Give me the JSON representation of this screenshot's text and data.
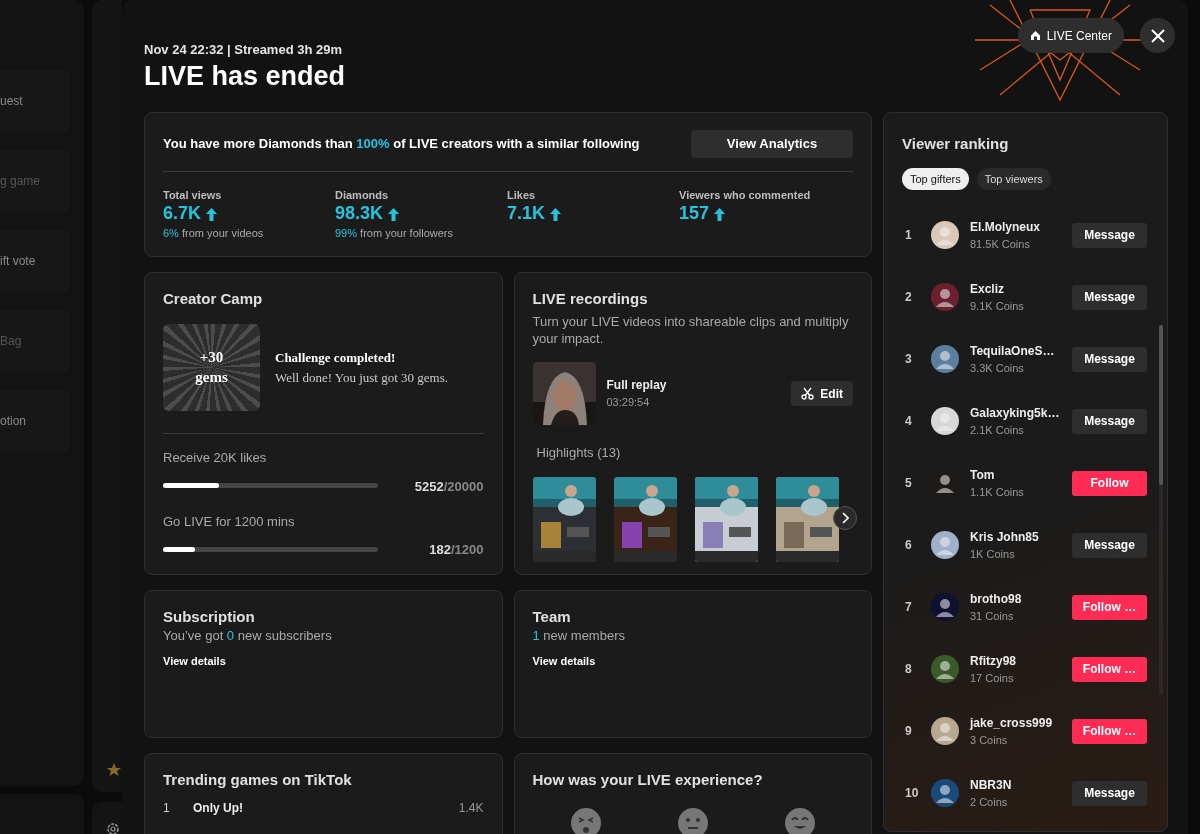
{
  "background_sidebar": {
    "items": [
      {
        "label": "uest",
        "dim": false
      },
      {
        "label": "g game",
        "dim": true
      },
      {
        "label": "ift vote",
        "dim": false
      },
      {
        "label": "Bag",
        "dim": true
      },
      {
        "label": "otion",
        "dim": false
      }
    ]
  },
  "header": {
    "meta": "Nov 24 22:32 | Streamed 3h 29m",
    "title": "LIVE has ended",
    "live_center_button": "LIVE Center"
  },
  "summary": {
    "headline_parts": [
      {
        "text": "You have more Diamonds than ",
        "accent": false
      },
      {
        "text": "100%",
        "accent": true
      },
      {
        "text": " of LIVE creators with a similar following",
        "accent": false
      }
    ],
    "analytics_button": "View Analytics",
    "stats": [
      {
        "label": "Total views",
        "value": "6.7K",
        "note_highlight": "6%",
        "note_text": " from your videos"
      },
      {
        "label": "Diamonds",
        "value": "98.3K",
        "note_highlight": "99%",
        "note_text": " from your followers"
      },
      {
        "label": "Likes",
        "value": "7.1K"
      },
      {
        "label": "Viewers who commented",
        "value": "157"
      }
    ]
  },
  "creator_camp": {
    "title": "Creator Camp",
    "badge": "+30 gems",
    "challenge_title": "Challenge completed!",
    "challenge_text": "Well done! You just got 30 gems.",
    "goals": [
      {
        "label": "Receive 20K likes",
        "level": 0.26,
        "current": "5252",
        "target": "/20000"
      },
      {
        "label": "Go LIVE for 1200 mins",
        "level": 0.15,
        "current": "182",
        "target": "/1200"
      }
    ]
  },
  "recordings": {
    "title": "LIVE recordings",
    "description": "Turn your LIVE videos into shareable clips and multiply your impact.",
    "replay": {
      "title": "Full replay",
      "duration": "03:29:54"
    },
    "edit_button": "Edit",
    "highlights_label": "Highlights (13)"
  },
  "subscription": {
    "title": "Subscription",
    "parts": [
      {
        "text": "You’ve got ",
        "accent": false
      },
      {
        "text": "0",
        "accent": true
      },
      {
        "text": " new subscribers",
        "accent": false
      }
    ],
    "link": "View details"
  },
  "team": {
    "title": "Team",
    "parts": [
      {
        "text": "1",
        "accent": true
      },
      {
        "text": " new members",
        "accent": false
      }
    ],
    "link": "View details"
  },
  "trending": {
    "title": "Trending games on TikTok",
    "games": [
      {
        "rank": "1",
        "name": "Only Up!",
        "count": "1.4K"
      }
    ]
  },
  "experience": {
    "title": "How was your LIVE experience?"
  },
  "viewer_ranking": {
    "title": "Viewer ranking",
    "tabs": [
      {
        "label": "Top gifters",
        "selected": true
      },
      {
        "label": "Top viewers",
        "selected": false
      }
    ],
    "viewers": [
      {
        "rank": "1",
        "name": "El.Molyneux",
        "coins": "81.5K Coins",
        "kind": "message",
        "button": "Message"
      },
      {
        "rank": "2",
        "name": "Excliz",
        "coins": "9.1K Coins",
        "kind": "message",
        "button": "Message"
      },
      {
        "rank": "3",
        "name": "TequilaOneS…",
        "coins": "3.3K Coins",
        "kind": "message",
        "button": "Message"
      },
      {
        "rank": "4",
        "name": "Galaxyking5k…",
        "coins": "2.1K Coins",
        "kind": "message",
        "button": "Message"
      },
      {
        "rank": "5",
        "name": "Tom",
        "coins": "1.1K Coins",
        "kind": "follow",
        "button": "Follow"
      },
      {
        "rank": "6",
        "name": "Kris John85",
        "coins": "1K Coins",
        "kind": "message",
        "button": "Message"
      },
      {
        "rank": "7",
        "name": "brotho98",
        "coins": "31 Coins",
        "kind": "follow",
        "button": "Follow …"
      },
      {
        "rank": "8",
        "name": "Rfitzy98",
        "coins": "17 Coins",
        "kind": "follow",
        "button": "Follow …"
      },
      {
        "rank": "9",
        "name": "jake_cross999",
        "coins": "3 Coins",
        "kind": "follow",
        "button": "Follow …"
      },
      {
        "rank": "10",
        "name": "NBR3N",
        "coins": "2 Coins",
        "kind": "message",
        "button": "Message"
      }
    ]
  }
}
